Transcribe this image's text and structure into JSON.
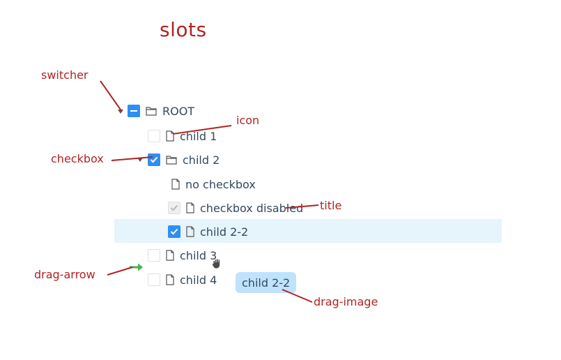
{
  "title": "slots",
  "annotations": {
    "switcher": "switcher",
    "icon": "icon",
    "checkbox": "checkbox",
    "title": "title",
    "drag_arrow": "drag-arrow",
    "drag_image": "drag-image"
  },
  "tree": {
    "root": "ROOT",
    "child1": "child 1",
    "child2": "child 2",
    "no_checkbox": "no checkbox",
    "checkbox_disabled": "checkbox disabled",
    "child2_2": "child 2-2",
    "child3": "child 3",
    "child4": "child 4"
  },
  "drag_image_label": "child 2-2",
  "colors": {
    "annotation": "#b22222",
    "checkbox_checked": "#2f8ff0",
    "selected_row": "#e6f4fb",
    "drag_image": "#bfe3fb",
    "drag_arrow": "#4caf50"
  }
}
